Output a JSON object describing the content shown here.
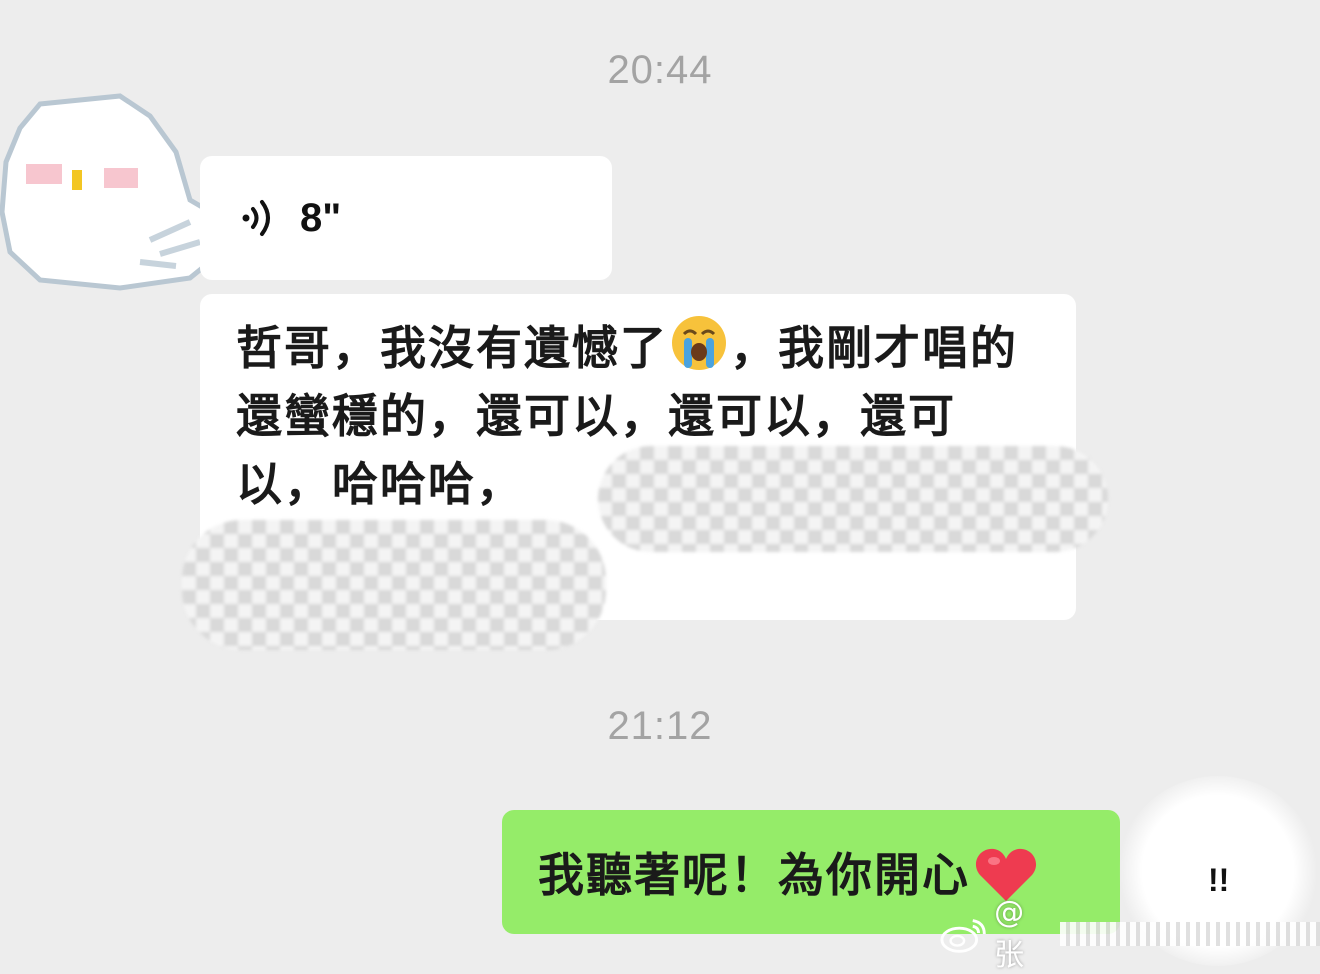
{
  "chat": {
    "timestamp_1": "20:44",
    "timestamp_2": "21:12",
    "voice_message": {
      "duration": "8\"",
      "icon": "voice-wave-icon"
    },
    "received_text": {
      "part1": "哲哥，我沒有遺憾了",
      "emoji": "loudly-crying-face-icon",
      "part2": "，我剛才唱的還蠻穩的，還可以，還可以，還可以，哈哈哈，"
    },
    "sent_text": {
      "text": "我聽著呢！為你開心",
      "emoji": "red-heart-icon"
    },
    "self_avatar_text": "!!"
  },
  "watermark": {
    "prefix": "@张"
  },
  "colors": {
    "background": "#ededed",
    "received_bubble": "#ffffff",
    "sent_bubble": "#95ec69",
    "timestamp": "#a3a3a3"
  }
}
